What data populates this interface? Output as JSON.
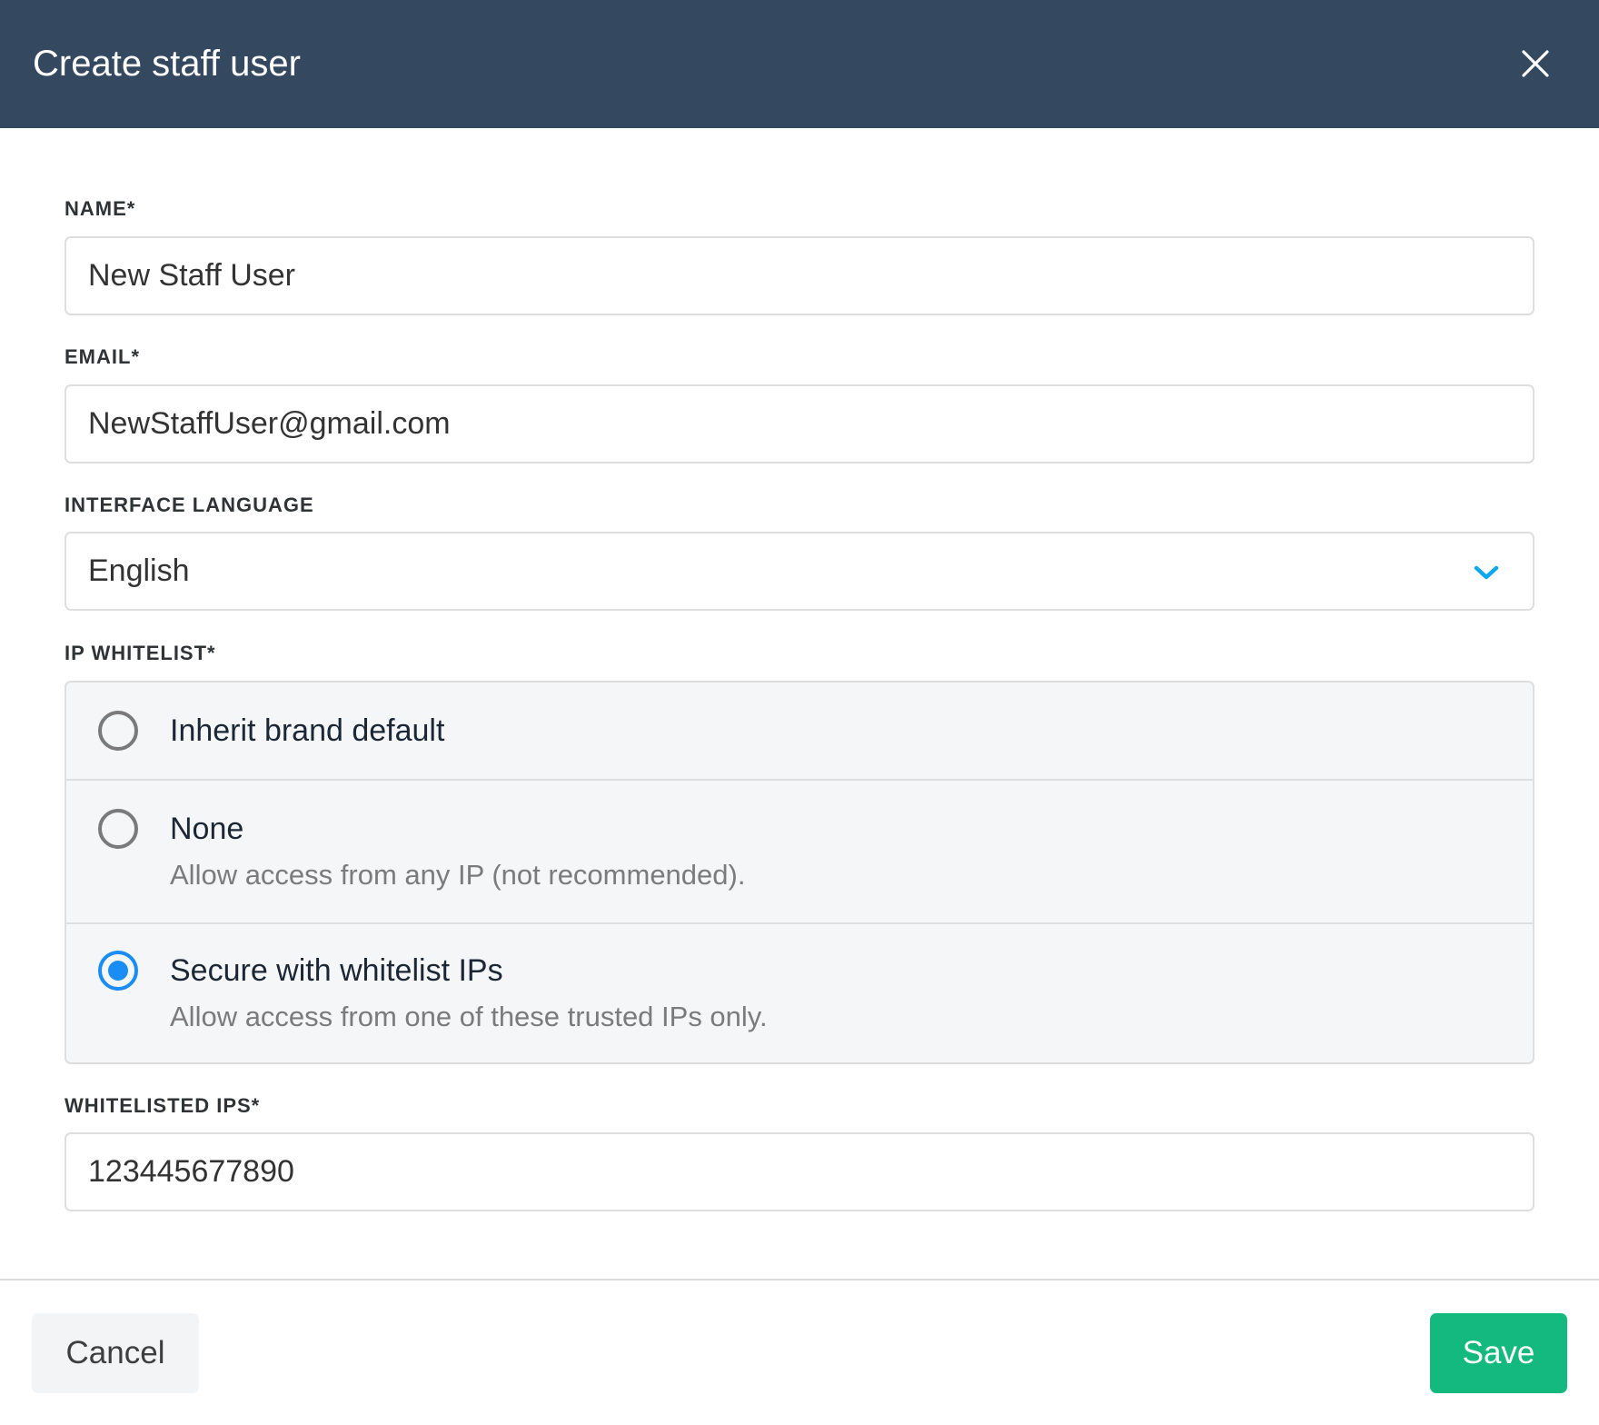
{
  "header": {
    "title": "Create staff user",
    "close_icon": "close-icon"
  },
  "form": {
    "name": {
      "label": "NAME*",
      "value": "New Staff User"
    },
    "email": {
      "label": "EMAIL*",
      "value": "NewStaffUser@gmail.com"
    },
    "language": {
      "label": "INTERFACE LANGUAGE",
      "value": "English",
      "icon": "chevron-down-icon",
      "icon_color": "#0fa8f0"
    },
    "ip_whitelist": {
      "label": "IP WHITELIST*",
      "options": [
        {
          "title": "Inherit brand default",
          "description": "",
          "checked": false
        },
        {
          "title": "None",
          "description": "Allow access from any IP (not recommended).",
          "checked": false
        },
        {
          "title": "Secure with whitelist IPs",
          "description": "Allow access from one of these trusted IPs only.",
          "checked": true
        }
      ],
      "selected_color": "#1a8df5"
    },
    "whitelisted_ips": {
      "label": "WHITELISTED IPS*",
      "value": "123445677890"
    }
  },
  "footer": {
    "cancel_label": "Cancel",
    "save_label": "Save",
    "save_color": "#13b97f"
  }
}
